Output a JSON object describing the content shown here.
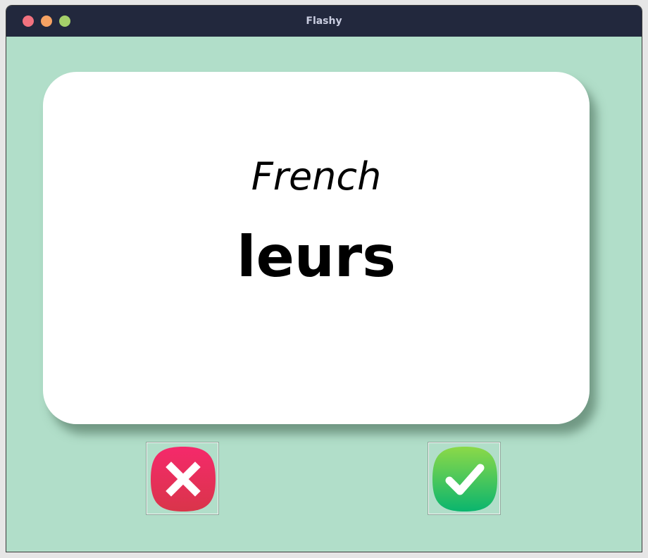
{
  "window": {
    "title": "Flashy"
  },
  "card": {
    "language": "French",
    "word": "leurs"
  },
  "buttons": {
    "wrong": {
      "icon": "cross-icon",
      "color": "#e8325a"
    },
    "right": {
      "icon": "check-icon",
      "color": "#3ccf5f"
    }
  },
  "colors": {
    "background": "#b1dec9",
    "titlebar": "#22283d",
    "card": "#ffffff"
  }
}
